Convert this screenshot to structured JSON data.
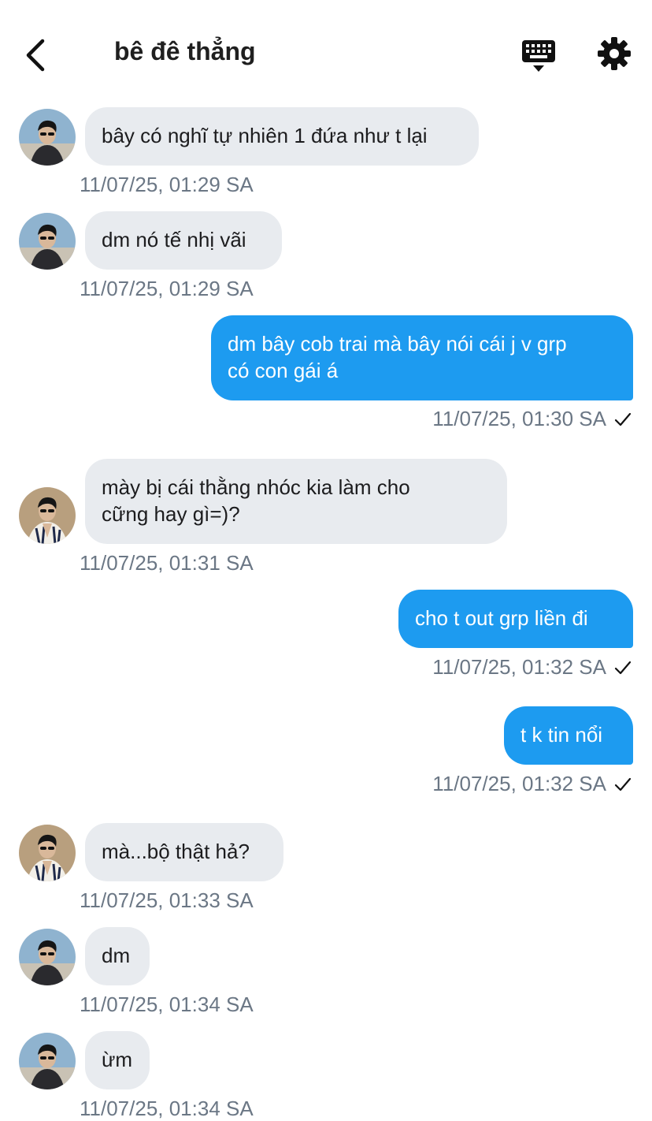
{
  "header": {
    "title": "bê đê thẳng",
    "back_icon": "chevron-left-icon",
    "keyboard_icon": "keyboard-icon",
    "settings_icon": "gear-icon"
  },
  "colors": {
    "incoming_bubble": "#e8ebef",
    "outgoing_bubble": "#1d9bf0",
    "timestamp": "#6b7785"
  },
  "messages": [
    {
      "side": "in",
      "avatar": "avatar-a",
      "text": "bây có nghĩ tự nhiên 1 đứa như t lại",
      "time": "11/07/25, 01:29 SA"
    },
    {
      "side": "in",
      "avatar": "avatar-a",
      "text": "dm nó tế nhị vãi",
      "time": "11/07/25, 01:29 SA"
    },
    {
      "side": "out",
      "text_line1": "dm bây cob trai mà bây nói cái j v grp",
      "text_line2": "có con gái á",
      "time": "11/07/25, 01:30 SA"
    },
    {
      "side": "in",
      "avatar": "avatar-b",
      "text_line1": "mày bị cái thằng nhóc kia làm cho",
      "text_line2": "cững hay gì=)?",
      "time": "11/07/25, 01:31 SA"
    },
    {
      "side": "out",
      "text": "cho t out grp liền đi",
      "time": "11/07/25, 01:32 SA"
    },
    {
      "side": "out",
      "text": "t k tin nổi",
      "time": "11/07/25, 01:32 SA"
    },
    {
      "side": "in",
      "avatar": "avatar-b",
      "text": "mà...bộ thật hả?",
      "time": "11/07/25, 01:33 SA"
    },
    {
      "side": "in",
      "avatar": "avatar-a",
      "text": "dm",
      "time": "11/07/25, 01:34 SA"
    },
    {
      "side": "in",
      "avatar": "avatar-a",
      "text": "ừm",
      "time": "11/07/25, 01:34 SA"
    }
  ]
}
